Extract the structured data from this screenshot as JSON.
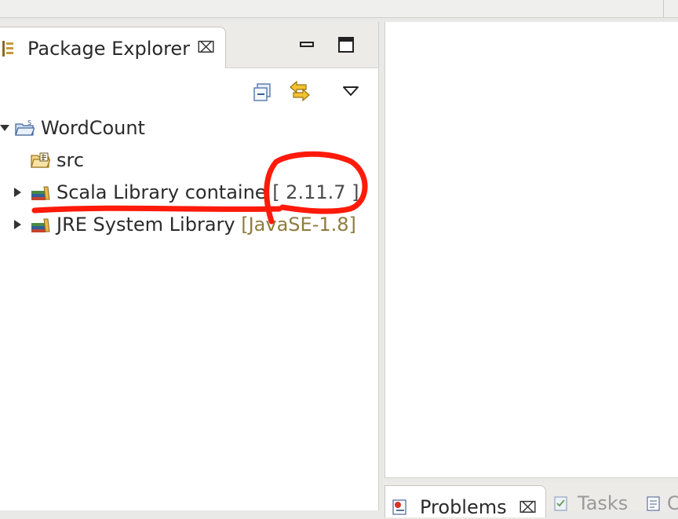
{
  "package_explorer": {
    "tab_title": "Package Explorer",
    "close_glyph": "⌧",
    "icons": {
      "tab": "package-explorer-icon",
      "minimize": "minimize-icon",
      "maximize": "maximize-icon",
      "collapse_all": "collapse-all-icon",
      "link_with_editor": "link-with-editor-icon",
      "view_menu": "view-menu-icon"
    }
  },
  "tree": {
    "project": {
      "label": "WordCount",
      "expanded": true,
      "icon": "scala-project-icon"
    },
    "items": [
      {
        "label": "src",
        "decoration": "",
        "icon": "source-folder-icon",
        "expandable": false
      },
      {
        "label": "Scala Library containe",
        "decoration": "[ 2.11.7 ]",
        "icon": "library-icon",
        "expandable": true
      },
      {
        "label": "JRE System Library",
        "decoration": "[JavaSE-1.8]",
        "icon": "library-icon",
        "expandable": true
      }
    ]
  },
  "bottom_panel": {
    "tabs": [
      {
        "label": "Problems",
        "active": true,
        "icon": "problems-icon"
      },
      {
        "label": "Tasks",
        "active": false,
        "icon": "tasks-icon"
      },
      {
        "label": "C",
        "active": false,
        "icon": "console-icon"
      }
    ]
  },
  "colors": {
    "decoration": "#8f7c3e",
    "annotation": "#ff1a0a",
    "panel_bg": "#ffffff",
    "chrome_bg": "#ecebe8"
  }
}
